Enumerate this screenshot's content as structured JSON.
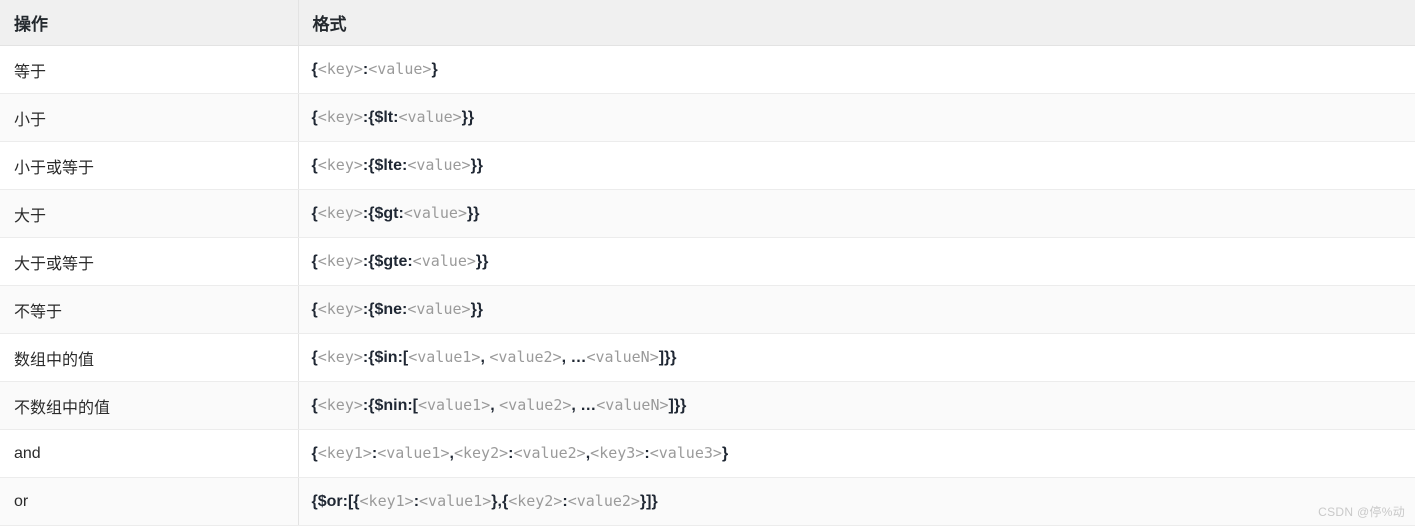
{
  "table": {
    "columns": [
      {
        "key": "operation",
        "label": "操作"
      },
      {
        "key": "format",
        "label": "格式"
      }
    ],
    "rows": [
      {
        "operation": "等于",
        "format_text": "{<key>:<value>}",
        "format_tokens": [
          {
            "t": "sy",
            "v": "{"
          },
          {
            "t": "ph",
            "v": "<key>"
          },
          {
            "t": "sy",
            "v": ":"
          },
          {
            "t": "ph",
            "v": "<value>"
          },
          {
            "t": "sy",
            "v": "}"
          }
        ]
      },
      {
        "operation": "小于",
        "format_text": "{<key>:{$lt:<value>}}",
        "format_tokens": [
          {
            "t": "sy",
            "v": "{"
          },
          {
            "t": "ph",
            "v": "<key>"
          },
          {
            "t": "sy",
            "v": ":{$lt:"
          },
          {
            "t": "ph",
            "v": "<value>"
          },
          {
            "t": "sy",
            "v": "}}"
          }
        ]
      },
      {
        "operation": "小于或等于",
        "format_text": "{<key>:{$lte:<value>}}",
        "format_tokens": [
          {
            "t": "sy",
            "v": "{"
          },
          {
            "t": "ph",
            "v": "<key>"
          },
          {
            "t": "sy",
            "v": ":{$lte:"
          },
          {
            "t": "ph",
            "v": "<value>"
          },
          {
            "t": "sy",
            "v": "}}"
          }
        ]
      },
      {
        "operation": "大于",
        "format_text": "{<key>:{$gt:<value>}}",
        "format_tokens": [
          {
            "t": "sy",
            "v": "{"
          },
          {
            "t": "ph",
            "v": "<key>"
          },
          {
            "t": "sy",
            "v": ":{$gt:"
          },
          {
            "t": "ph",
            "v": "<value>"
          },
          {
            "t": "sy",
            "v": "}}"
          }
        ]
      },
      {
        "operation": "大于或等于",
        "format_text": "{<key>:{$gte:<value>}}",
        "format_tokens": [
          {
            "t": "sy",
            "v": "{"
          },
          {
            "t": "ph",
            "v": "<key>"
          },
          {
            "t": "sy",
            "v": ":{$gte:"
          },
          {
            "t": "ph",
            "v": "<value>"
          },
          {
            "t": "sy",
            "v": "}}"
          }
        ]
      },
      {
        "operation": "不等于",
        "format_text": "{<key>:{$ne:<value>}}",
        "format_tokens": [
          {
            "t": "sy",
            "v": "{"
          },
          {
            "t": "ph",
            "v": "<key>"
          },
          {
            "t": "sy",
            "v": ":{$ne:"
          },
          {
            "t": "ph",
            "v": "<value>"
          },
          {
            "t": "sy",
            "v": "}}"
          }
        ]
      },
      {
        "operation": "数组中的值",
        "format_text": "{<key>:{$in:[<value1>, <value2>, …<valueN>]}}",
        "format_tokens": [
          {
            "t": "sy",
            "v": "{"
          },
          {
            "t": "ph",
            "v": "<key>"
          },
          {
            "t": "sy",
            "v": ":{$in:["
          },
          {
            "t": "ph",
            "v": "<value1>"
          },
          {
            "t": "sy",
            "v": ", "
          },
          {
            "t": "ph",
            "v": "<value2>"
          },
          {
            "t": "sy",
            "v": ", …"
          },
          {
            "t": "ph",
            "v": "<valueN>"
          },
          {
            "t": "sy",
            "v": "]}}"
          }
        ]
      },
      {
        "operation": "不数组中的值",
        "format_text": "{<key>:{$nin:[<value1>, <value2>, …<valueN>]}}",
        "format_tokens": [
          {
            "t": "sy",
            "v": "{"
          },
          {
            "t": "ph",
            "v": "<key>"
          },
          {
            "t": "sy",
            "v": ":{$nin:["
          },
          {
            "t": "ph",
            "v": "<value1>"
          },
          {
            "t": "sy",
            "v": ", "
          },
          {
            "t": "ph",
            "v": "<value2>"
          },
          {
            "t": "sy",
            "v": ", …"
          },
          {
            "t": "ph",
            "v": "<valueN>"
          },
          {
            "t": "sy",
            "v": "]}}"
          }
        ]
      },
      {
        "operation": "and",
        "format_text": "{<key1>:<value1>,<key2>:<value2>,<key3>:<value3>}",
        "format_tokens": [
          {
            "t": "sy",
            "v": "{"
          },
          {
            "t": "ph",
            "v": "<key1>"
          },
          {
            "t": "sy",
            "v": ":"
          },
          {
            "t": "ph",
            "v": "<value1>"
          },
          {
            "t": "sy",
            "v": ","
          },
          {
            "t": "ph",
            "v": "<key2>"
          },
          {
            "t": "sy",
            "v": ":"
          },
          {
            "t": "ph",
            "v": "<value2>"
          },
          {
            "t": "sy",
            "v": ","
          },
          {
            "t": "ph",
            "v": "<key3>"
          },
          {
            "t": "sy",
            "v": ":"
          },
          {
            "t": "ph",
            "v": "<value3>"
          },
          {
            "t": "sy",
            "v": "}"
          }
        ]
      },
      {
        "operation": "or",
        "format_text": "{$or:[{<key1>:<value1>},{<key2>:<value2>}]}",
        "format_tokens": [
          {
            "t": "sy",
            "v": "{$or:[{"
          },
          {
            "t": "ph",
            "v": "<key1>"
          },
          {
            "t": "sy",
            "v": ":"
          },
          {
            "t": "ph",
            "v": "<value1>"
          },
          {
            "t": "sy",
            "v": "},{"
          },
          {
            "t": "ph",
            "v": "<key2>"
          },
          {
            "t": "sy",
            "v": ":"
          },
          {
            "t": "ph",
            "v": "<value2>"
          },
          {
            "t": "sy",
            "v": "}]}"
          }
        ]
      }
    ]
  },
  "watermark": {
    "text": "CSDN @停%动"
  },
  "colors": {
    "header_bg": "#f0f0f0",
    "row_bg_odd": "#ffffff",
    "row_bg_even": "#fafafa",
    "border": "#ececec",
    "column_divider": "#e3e3e3",
    "text": "#2b2b2b",
    "syntax": "#1f2733",
    "placeholder": "#9a9a9a",
    "watermark": "#c9c9c9"
  }
}
